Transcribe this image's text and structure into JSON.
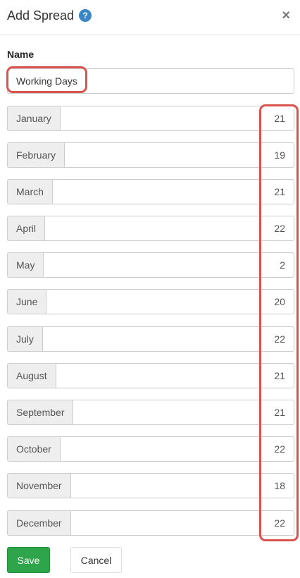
{
  "dialog": {
    "title": "Add Spread",
    "help_icon_glyph": "?",
    "close_icon_glyph": "×"
  },
  "form": {
    "name_label": "Name",
    "name_value": "Working Days"
  },
  "months": [
    {
      "label": "January",
      "value": "21"
    },
    {
      "label": "February",
      "value": "19"
    },
    {
      "label": "March",
      "value": "21"
    },
    {
      "label": "April",
      "value": "22"
    },
    {
      "label": "May",
      "value": "2"
    },
    {
      "label": "June",
      "value": "20"
    },
    {
      "label": "July",
      "value": "22"
    },
    {
      "label": "August",
      "value": "21"
    },
    {
      "label": "September",
      "value": "21"
    },
    {
      "label": "October",
      "value": "22"
    },
    {
      "label": "November",
      "value": "18"
    },
    {
      "label": "December",
      "value": "22"
    }
  ],
  "buttons": {
    "save_label": "Save",
    "cancel_label": "Cancel"
  },
  "colors": {
    "save_button": "#2ea54a",
    "help_icon": "#3a87c8",
    "highlight": "#d9534f"
  }
}
